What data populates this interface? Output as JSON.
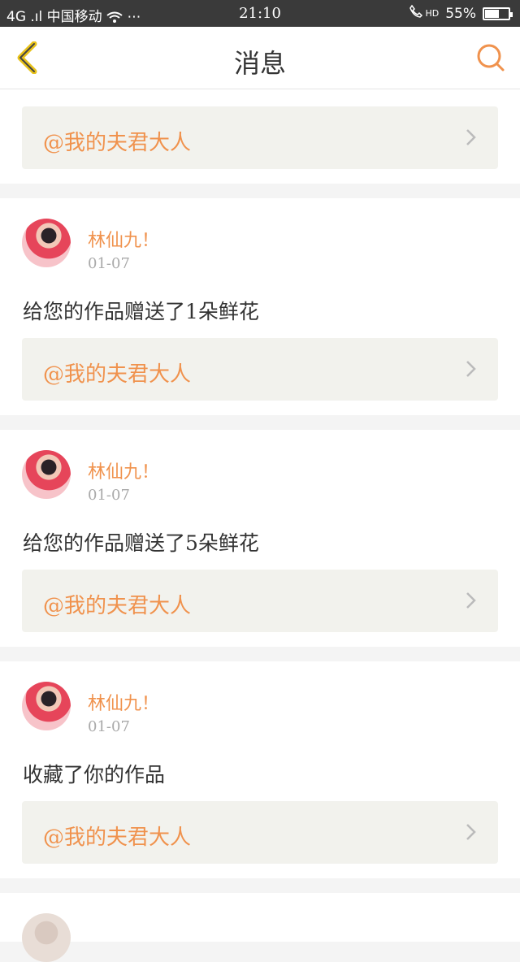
{
  "status_bar": {
    "carrier": "4G .ıl 中国移动",
    "extras": "⋯",
    "time": "21:10",
    "network": "HD",
    "battery": "55%",
    "battery_level": 0.55
  },
  "nav": {
    "title": "消息",
    "back_icon": "chevron-left-icon",
    "search_icon": "search-icon",
    "accent": "#f0924d"
  },
  "top_card": {
    "link_text": "@我的夫君大人"
  },
  "messages": [
    {
      "user": "林仙九！",
      "date": "01-07",
      "text": "给您的作品赠送了1朵鲜花",
      "link_text": "@我的夫君大人"
    },
    {
      "user": "林仙九！",
      "date": "01-07",
      "text": "给您的作品赠送了5朵鲜花",
      "link_text": "@我的夫君大人"
    },
    {
      "user": "林仙九！",
      "date": "01-07",
      "text": "收藏了你的作品",
      "link_text": "@我的夫君大人"
    }
  ]
}
